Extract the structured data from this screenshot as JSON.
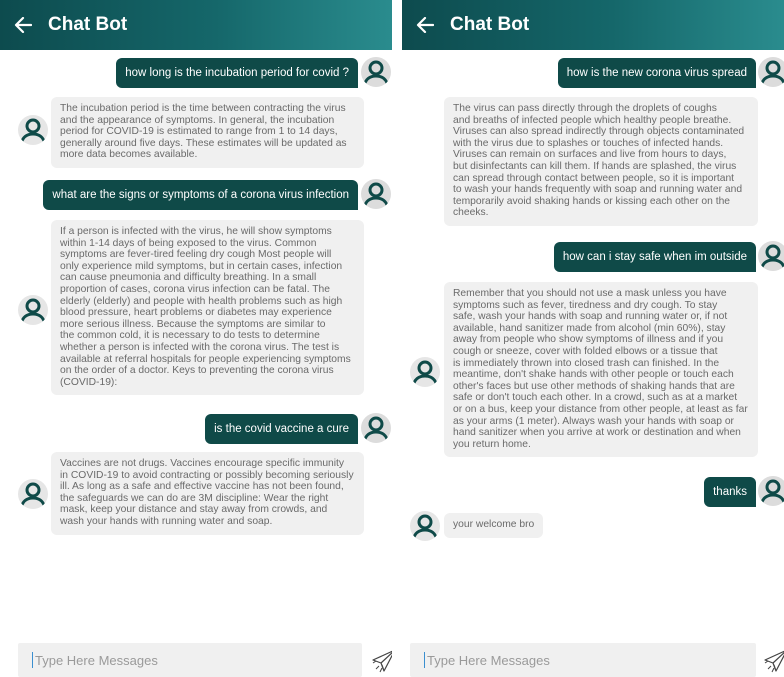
{
  "left": {
    "header": {
      "title": "Chat Bot",
      "back_icon": "arrow-left-icon"
    },
    "messages": [
      {
        "from": "user",
        "text": "how long is the incubation period for covid ?"
      },
      {
        "from": "bot",
        "lines": [
          "The incubation period is the time between contracting the virus",
          "and the appearance of symptoms. In general, the incubation",
          "period for COVID-19 is estimated to range from 1 to 14 days,",
          "generally around five days. These estimates will be updated as",
          "more data becomes available."
        ]
      },
      {
        "from": "user",
        "text": "what are the signs or symptoms of a corona virus infection"
      },
      {
        "from": "bot",
        "lines": [
          "If a person is infected with the virus, he will show symptoms",
          "within 1-14 days of being exposed to the virus. Common",
          "symptoms are fever-tired feeling dry cough Most people will",
          "only experience mild symptoms, but in certain cases, infection",
          "can cause pneumonia and difficulty breathing. In a small",
          "proportion of cases, corona virus infection can be fatal. The",
          "elderly (elderly) and people with health problems such as high",
          "blood pressure, heart problems or diabetes may experience",
          "more serious illness. Because the symptoms are similar to",
          "the common cold, it is necessary to do tests to determine",
          "whether a person is infected with the corona virus. The test is",
          "available at referral hospitals for people experiencing symptoms",
          "on the order of a doctor. Keys to preventing the corona virus",
          "(COVID-19):"
        ]
      },
      {
        "from": "user",
        "text": "is the covid vaccine a cure"
      },
      {
        "from": "bot",
        "lines": [
          "Vaccines are not drugs. Vaccines encourage specific immunity",
          "in COVID-19 to avoid contracting or possibly becoming seriously",
          "ill. As long as a safe and effective vaccine has not been found,",
          "the safeguards we can do are 3M discipline: Wear the right",
          "mask, keep your distance and stay away from crowds, and",
          "wash your hands with running water and soap."
        ]
      }
    ],
    "input": {
      "placeholder": "Type Here Messages"
    }
  },
  "right": {
    "header": {
      "title": "Chat Bot",
      "back_icon": "arrow-left-icon"
    },
    "messages": [
      {
        "from": "user",
        "text": "how is the new corona virus spread"
      },
      {
        "from": "bot",
        "lines": [
          "The virus can pass directly through the droplets of coughs",
          "and breaths of infected people which healthy people breathe.",
          "Viruses can also spread indirectly through objects contaminated",
          "with the virus due to splashes or touches of infected hands.",
          "Viruses can remain on surfaces and live from hours to days,",
          "but disinfectants can kill them. If hands are splashed, the virus",
          "can spread through contact between people, so it is important",
          "to wash your hands frequently with soap and running water and",
          "temporarily avoid shaking hands or kissing each other on the",
          "cheeks."
        ]
      },
      {
        "from": "user",
        "text": "how can i stay safe when im outside"
      },
      {
        "from": "bot",
        "lines": [
          "Remember that you should not use a mask unless you have",
          "symptoms such as fever, tiredness and dry cough. To stay",
          "safe, wash your hands with soap and running water or, if not",
          "available, hand sanitizer made from alcohol (min 60%), stay",
          "away from people who show symptoms of illness and if you",
          "cough or sneeze, cover with folded elbows or a tissue that",
          "is immediately thrown into closed trash can finished. In the",
          "meantime, don't shake hands with other people or touch each",
          "other's faces but use other methods of shaking hands that are",
          "safe or don't touch each other. In a crowd, such as at a market",
          "or on a bus, keep your distance from other people, at least as far",
          "as your arms (1 meter). Always wash your hands with soap or",
          "hand sanitizer when you arrive at work or destination and when",
          "you return home."
        ]
      },
      {
        "from": "user",
        "text": "thanks"
      },
      {
        "from": "bot",
        "lines": [
          "your welcome bro"
        ]
      }
    ],
    "input": {
      "placeholder": "Type Here Messages"
    }
  },
  "icons": {
    "avatar": "person-avatar-icon",
    "send": "send-paper-plane-icon"
  },
  "colors": {
    "header_dark": "#0d4b4e",
    "header_light": "#2a8c8e",
    "user_bubble": "#0f4a48",
    "bot_bubble": "#f0f0f0"
  }
}
